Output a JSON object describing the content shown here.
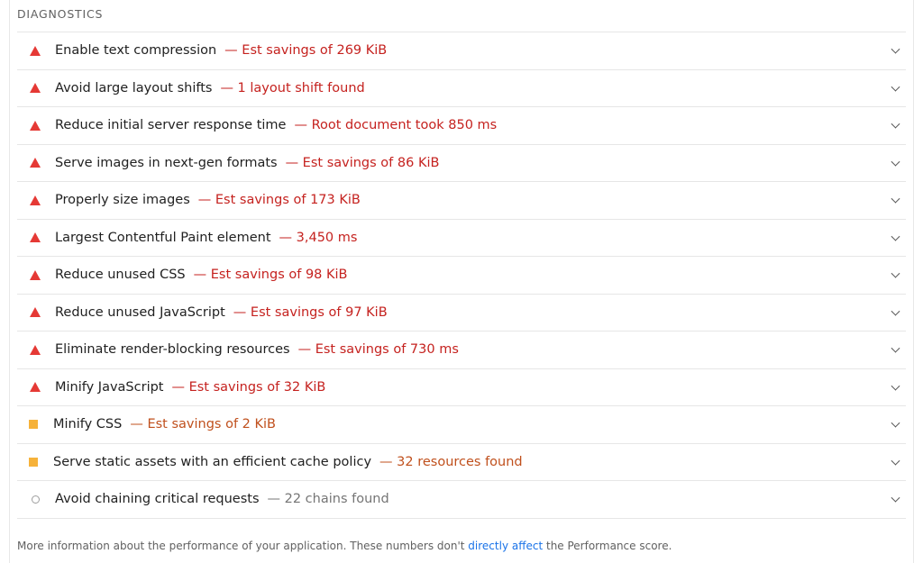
{
  "section": {
    "title": "DIAGNOSTICS"
  },
  "items": [
    {
      "title": "Enable text compression",
      "detail": "— Est savings of 269 KiB",
      "status": "fail"
    },
    {
      "title": "Avoid large layout shifts",
      "detail": "— 1 layout shift found",
      "status": "fail"
    },
    {
      "title": "Reduce initial server response time",
      "detail": "— Root document took 850 ms",
      "status": "fail"
    },
    {
      "title": "Serve images in next-gen formats",
      "detail": "— Est savings of 86 KiB",
      "status": "fail"
    },
    {
      "title": "Properly size images",
      "detail": "— Est savings of 173 KiB",
      "status": "fail"
    },
    {
      "title": "Largest Contentful Paint element",
      "detail": "— 3,450 ms",
      "status": "fail"
    },
    {
      "title": "Reduce unused CSS",
      "detail": "— Est savings of 98 KiB",
      "status": "fail"
    },
    {
      "title": "Reduce unused JavaScript",
      "detail": "— Est savings of 97 KiB",
      "status": "fail"
    },
    {
      "title": "Eliminate render-blocking resources",
      "detail": "— Est savings of 730 ms",
      "status": "fail"
    },
    {
      "title": "Minify JavaScript",
      "detail": "— Est savings of 32 KiB",
      "status": "fail"
    },
    {
      "title": "Minify CSS",
      "detail": "— Est savings of 2 KiB",
      "status": "average"
    },
    {
      "title": "Serve static assets with an efficient cache policy",
      "detail": "— 32 resources found",
      "status": "average"
    },
    {
      "title": "Avoid chaining critical requests",
      "detail": "— 22 chains found",
      "status": "informative"
    }
  ],
  "footer": {
    "text_before": "More information about the performance of your application. These numbers don't ",
    "link": "directly affect",
    "text_after": " the Performance score."
  },
  "colors": {
    "fail": "#e53935",
    "average": "#f6b23a",
    "informative": "#9e9e9e",
    "link": "#1a73e8"
  }
}
